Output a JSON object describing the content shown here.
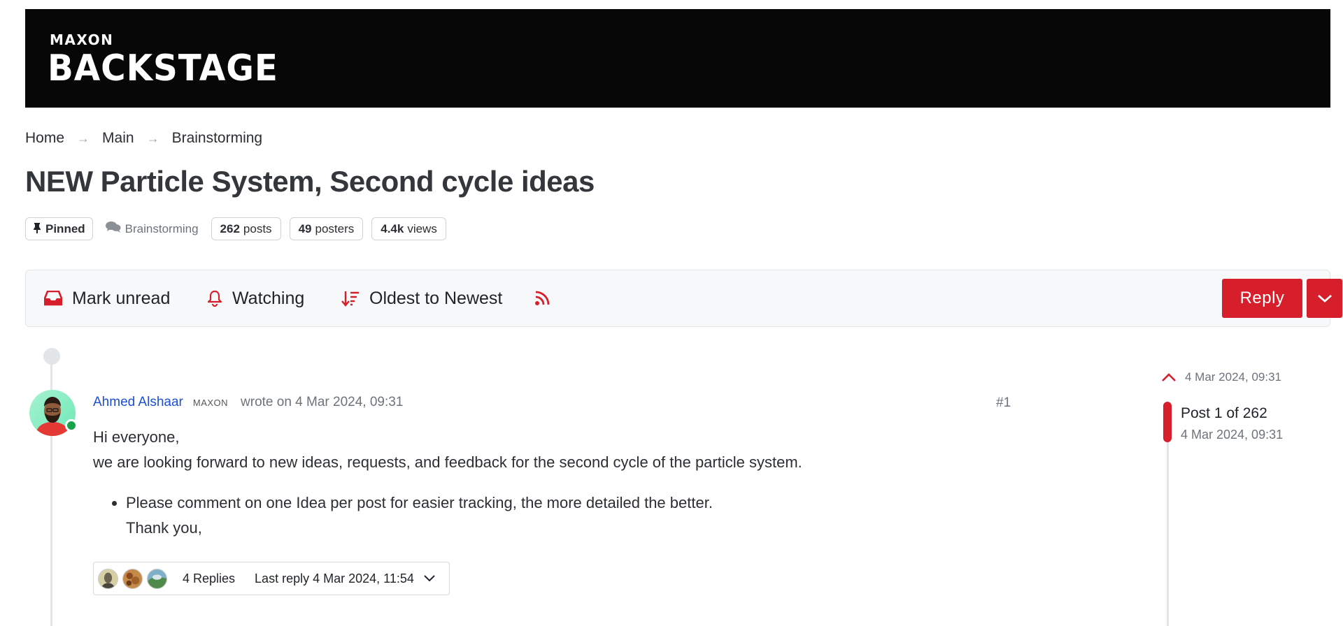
{
  "header": {
    "brand_top": "MAXON",
    "brand_main": "BACKSTAGE"
  },
  "breadcrumb": [
    "Home",
    "Main",
    "Brainstorming"
  ],
  "topic": {
    "title": "NEW Particle System, Second cycle ideas",
    "pinned_label": "Pinned",
    "category": "Brainstorming",
    "posts_count": "262",
    "posts_label": "posts",
    "posters_count": "49",
    "posters_label": "posters",
    "views_count": "4.4k",
    "views_label": "views"
  },
  "toolbar": {
    "mark_unread": "Mark unread",
    "watching": "Watching",
    "sort": "Oldest to Newest",
    "reply": "Reply"
  },
  "post": {
    "author": "Ahmed Alshaar",
    "org_badge": "MAXON",
    "wrote": "wrote on 4 Mar 2024, 09:31",
    "number": "#1",
    "line1": "Hi everyone,",
    "line2": "we are looking forward to new ideas, requests, and feedback for the second cycle of the particle system.",
    "bullet": "Please comment on one Idea per post for easier tracking, the more detailed the better.",
    "thanks": "Thank you,",
    "replies": "4 Replies",
    "last_reply": "Last reply 4 Mar 2024, 11:54"
  },
  "navigator": {
    "top_date": "4 Mar 2024, 09:31",
    "position": "Post 1 of 262",
    "current_date": "4 Mar 2024, 09:31"
  },
  "colors": {
    "accent": "#d71f2b",
    "link": "#1d4ed8",
    "online": "#16a34a",
    "banner": "#070707"
  }
}
